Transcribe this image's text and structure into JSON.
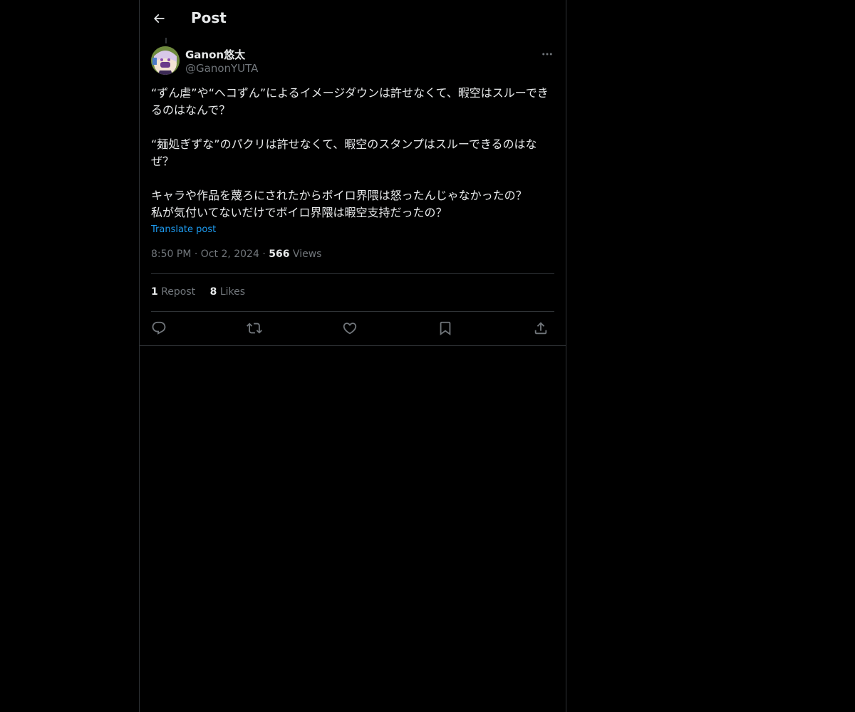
{
  "header": {
    "title": "Post"
  },
  "author": {
    "display_name": "Ganon悠太",
    "handle": "@GanonYUTA"
  },
  "post": {
    "text": "“ずん虐”や“ヘコずん”によるイメージダウンは許せなくて、暇空はスルーできるのはなんで？\n\n“麺処ぎずな”のパクリは許せなくて、暇空のスタンプはスルーできるのはなぜ？\n\nキャラや作品を蔑ろにされたからボイロ界隈は怒ったんじゃなかったの？\n私が気付いてないだけでボイロ界隈は暇空支持だったの？",
    "translate_label": "Translate post",
    "time": "8:50 PM",
    "date": "Oct 2, 2024",
    "views_count": "566",
    "views_label": "Views"
  },
  "stats": {
    "reposts_count": "1",
    "reposts_label": "Repost",
    "likes_count": "8",
    "likes_label": "Likes"
  },
  "icons": {
    "back": "arrow-left-icon",
    "more": "more-horizontal-icon",
    "reply": "reply-icon",
    "repost": "repost-icon",
    "like": "heart-icon",
    "bookmark": "bookmark-icon",
    "share": "share-icon"
  },
  "colors": {
    "background": "#000000",
    "text": "#e7e9ea",
    "secondary": "#71767b",
    "link": "#1d9bf0",
    "border": "#2f3336"
  }
}
